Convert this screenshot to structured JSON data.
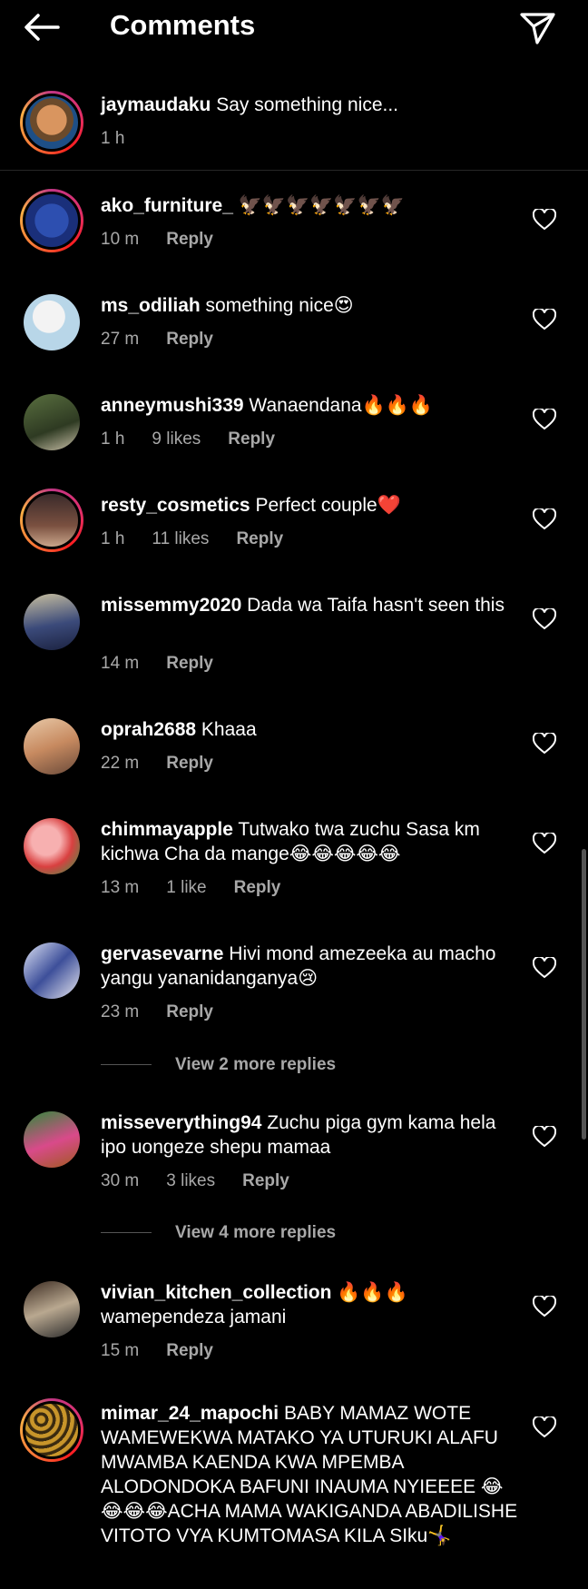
{
  "header": {
    "title": "Comments"
  },
  "caption": {
    "username": "jaymaudaku",
    "text": "Say something nice...",
    "time": "1 h"
  },
  "comments": [
    {
      "username": "ako_furniture_",
      "text": "🦅🦅🦅🦅🦅🦅🦅",
      "time": "10 m",
      "likes": "",
      "reply": "Reply"
    },
    {
      "username": "ms_odiliah",
      "text": "something nice😍",
      "time": "27 m",
      "likes": "",
      "reply": "Reply"
    },
    {
      "username": "anneymushi339",
      "text": "Wanaendana🔥🔥🔥",
      "time": "1 h",
      "likes": "9 likes",
      "reply": "Reply"
    },
    {
      "username": "resty_cosmetics",
      "text": "Perfect couple❤️",
      "time": "1 h",
      "likes": "11 likes",
      "reply": "Reply"
    },
    {
      "username": "missemmy2020",
      "text": "Dada wa Taifa hasn't seen this",
      "time": "14 m",
      "likes": "",
      "reply": "Reply"
    },
    {
      "username": "oprah2688",
      "text": "Khaaa",
      "time": "22 m",
      "likes": "",
      "reply": "Reply"
    },
    {
      "username": "chimmayapple",
      "text": "Tutwako twa zuchu Sasa km kichwa Cha da mange😂😂😂😂😂",
      "time": "13 m",
      "likes": "1 like",
      "reply": "Reply"
    },
    {
      "username": "gervasevarne",
      "text": "Hivi mond amezeeka au macho yangu yananidanganya😢",
      "time": "23 m",
      "likes": "",
      "reply": "Reply",
      "more": "View 2 more replies"
    },
    {
      "username": "misseverything94",
      "text": "Zuchu piga gym kama hela ipo uongeze shepu mamaa",
      "time": "30 m",
      "likes": "3 likes",
      "reply": "Reply",
      "more": "View 4 more replies"
    },
    {
      "username": "vivian_kitchen_collection",
      "text": "🔥🔥🔥 wamependeza jamani",
      "time": "15 m",
      "likes": "",
      "reply": "Reply"
    },
    {
      "username": "mimar_24_mapochi",
      "text": "BABY MAMAZ WOTE WAMEWEKWA MATAKO YA UTURUKI ALAFU MWAMBA KAENDA KWA MPEMBA ALODONDOKA BAFUNI INAUMA NYIEEEE 😂😂😂😂ACHA MAMA WAKIGANDA ABADILISHE VITOTO VYA KUMTOMASA KILA SIku🤸‍♀️",
      "time": "",
      "likes": "",
      "reply": ""
    }
  ]
}
